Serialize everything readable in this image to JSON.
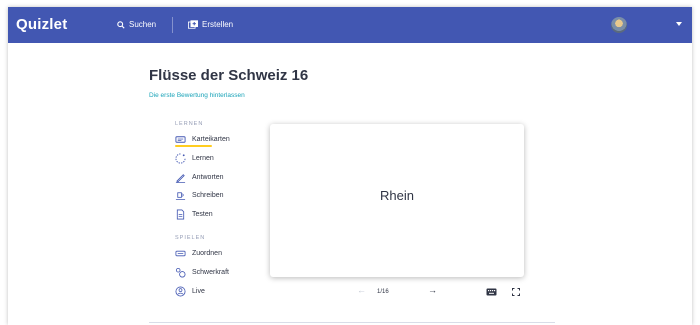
{
  "navbar": {
    "logo": "Quizlet",
    "search_label": "Suchen",
    "create_label": "Erstellen"
  },
  "set": {
    "title": "Flüsse der Schweiz 16",
    "rating_link": "Die erste Bewertung hinterlassen"
  },
  "sidebar": {
    "learn_section": "LERNEN",
    "learn_items": [
      {
        "label": "Karteikarten",
        "icon": "flashcards-icon",
        "active": true
      },
      {
        "label": "Lernen",
        "icon": "learn-icon"
      },
      {
        "label": "Antworten",
        "icon": "write-pen-icon"
      },
      {
        "label": "Schreiben",
        "icon": "spell-icon"
      },
      {
        "label": "Testen",
        "icon": "test-document-icon"
      }
    ],
    "play_section": "SPIELEN",
    "play_items": [
      {
        "label": "Zuordnen",
        "icon": "match-icon"
      },
      {
        "label": "Schwerkraft",
        "icon": "gravity-icon"
      },
      {
        "label": "Live",
        "icon": "live-icon"
      }
    ]
  },
  "card": {
    "term": "Rhein"
  },
  "controls": {
    "counter": "1/16",
    "prev_icon": "arrow-left-icon",
    "next_icon": "arrow-right-icon",
    "keyboard_icon": "keyboard-icon",
    "fullscreen_icon": "fullscreen-icon"
  },
  "colors": {
    "brand": "#4257b2",
    "link": "#1aa3b8",
    "active_underline": "#ffcd1f",
    "text": "#303545",
    "muted": "#939bb4"
  }
}
